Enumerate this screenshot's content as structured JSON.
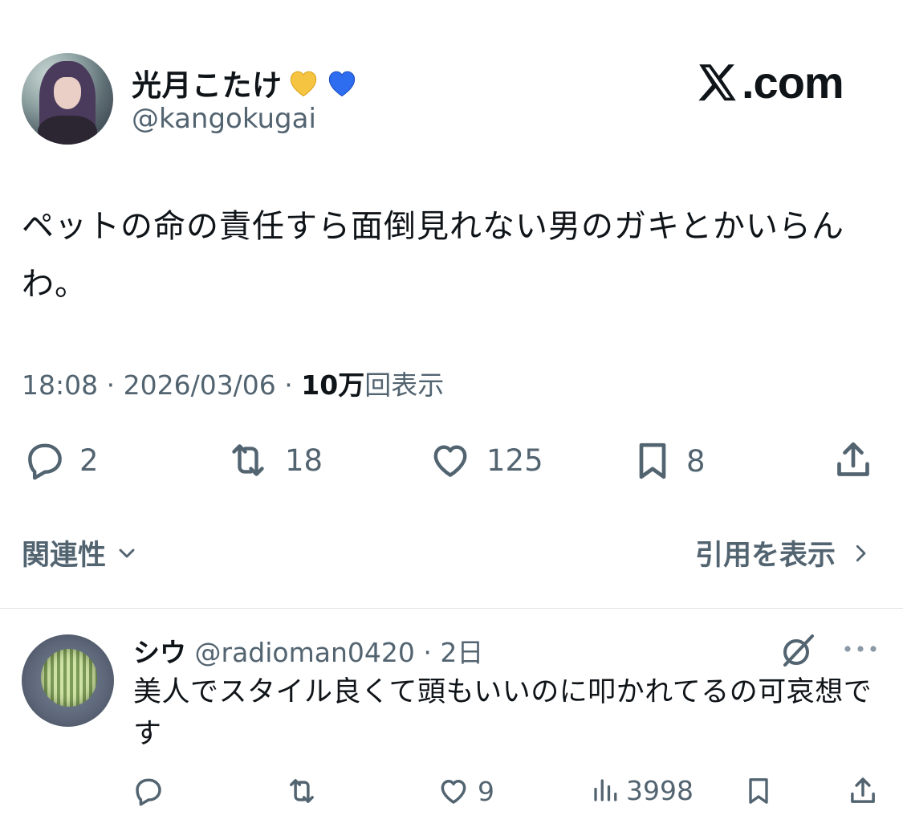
{
  "tweet": {
    "display_name": "光月こたけ",
    "handle": "@kangokugai",
    "text": "ペットの命の責任すら面倒見れない男のガキとかいらんわ。",
    "time": "18:08",
    "date": "2026/03/06",
    "views_count": "10万",
    "views_label": "回表示",
    "badges": [
      "yellow-heart-icon",
      "blue-heart-icon"
    ]
  },
  "brand": {
    "label": ".com",
    "x_glyph": "𝕏"
  },
  "actions": {
    "replies": "2",
    "reposts": "18",
    "likes": "125",
    "bookmarks": "8"
  },
  "filters": {
    "related_label": "関連性",
    "quotes_label": "引用を表示"
  },
  "reply": {
    "name": "シウ",
    "handle": "@radioman0420",
    "age": "2日",
    "text": "美人でスタイル良くて頭もいいのに叩かれてるの可哀想です",
    "likes": "9",
    "views": "3998"
  },
  "colors": {
    "text_primary": "#0f1419",
    "text_secondary": "#536471",
    "heart_yellow": "#f5c542",
    "heart_blue": "#2f6df0",
    "divider": "#e1e5e8"
  }
}
